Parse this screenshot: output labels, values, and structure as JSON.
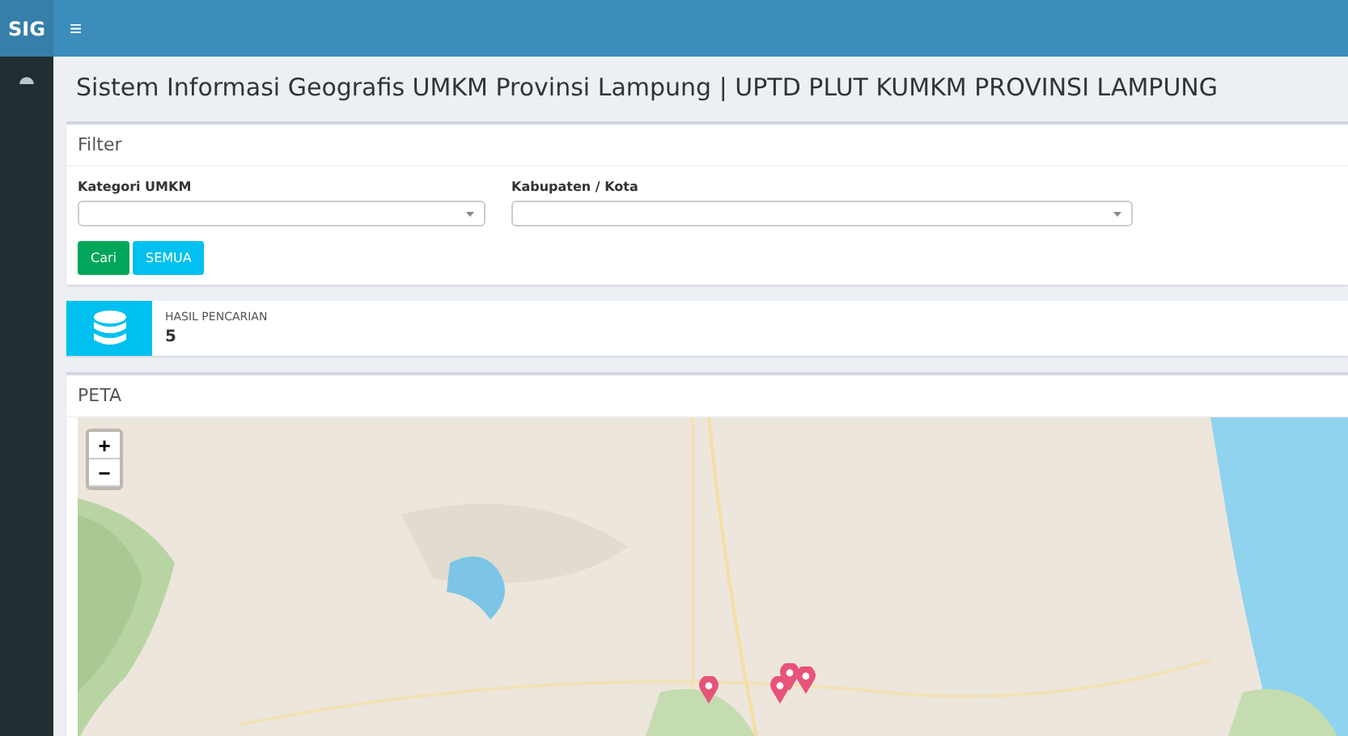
{
  "brand": "SIG",
  "menu_icon": "≡",
  "page_title": "Sistem Informasi Geografis UMKM Provinsi Lampung | UPTD PLUT KUMKM PROVINSI LAMPUNG",
  "filter": {
    "title": "Filter",
    "fields": [
      {
        "label": "Kategori UMKM"
      },
      {
        "label": "Kabupaten / Kota"
      }
    ],
    "buttons": [
      {
        "label": "Cari",
        "kind": "success"
      },
      {
        "label": "SEMUA",
        "kind": "info"
      }
    ]
  },
  "result": {
    "label": "HASIL PENCARIAN",
    "value": "5"
  },
  "map": {
    "title": "PETA",
    "zoom_in": "+",
    "zoom_out": "−"
  }
}
